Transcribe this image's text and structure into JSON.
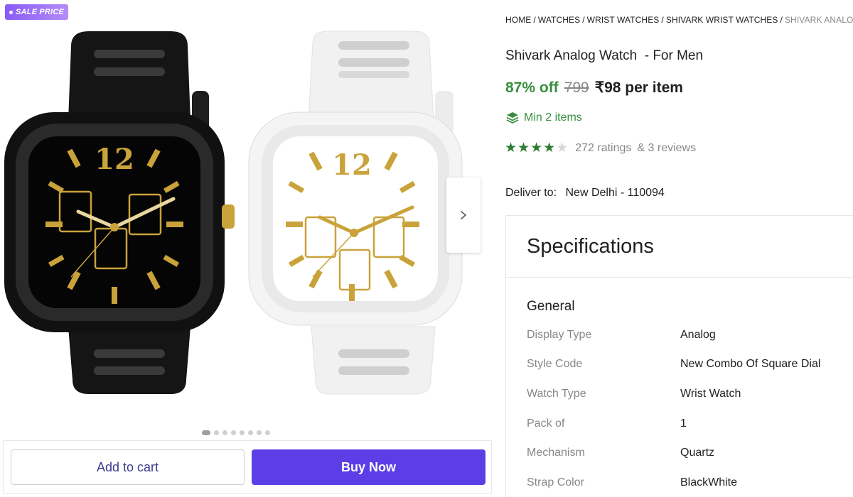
{
  "badge": {
    "label": "SALE PRICE"
  },
  "gallery": {
    "image_alt": "Pack of two square-dial analog watches, black and white",
    "dial_numeral": "12",
    "dots_count": 8,
    "active_dot": 0
  },
  "actions": {
    "add_to_cart": "Add to cart",
    "buy_now": "Buy Now"
  },
  "breadcrumb": [
    "HOME",
    "WATCHES",
    "WRIST WATCHES",
    "SHIVARK WRIST WATCHES"
  ],
  "breadcrumb_current": "SHIVARK ANALO",
  "product": {
    "title": "Shivark Analog Watch  - For Men",
    "discount": "87% off",
    "mrp": "799",
    "price": "₹98 per item",
    "min_items": "Min 2 items",
    "rating": 4,
    "rating_max": 5,
    "ratings_text": "272 ratings",
    "reviews_text": "& 3 reviews"
  },
  "delivery": {
    "label": "Deliver to:",
    "location": "New Delhi - 110094"
  },
  "specifications": {
    "title": "Specifications",
    "group": "General",
    "rows": [
      {
        "key": "Display Type",
        "value": "Analog"
      },
      {
        "key": "Style Code",
        "value": "New Combo Of Square Dial"
      },
      {
        "key": "Watch Type",
        "value": "Wrist Watch"
      },
      {
        "key": "Pack of",
        "value": "1"
      },
      {
        "key": "Mechanism",
        "value": "Quartz"
      },
      {
        "key": "Strap Color",
        "value": "BlackWhite"
      }
    ]
  },
  "colors": {
    "discount_green": "#388e3c",
    "buy_button": "#5b3ee6",
    "badge_purple": "#8a5cf6",
    "watch_gold": "#c9a23a"
  },
  "icons": {
    "next": "chevron-right-icon",
    "min_items": "layers-icon",
    "star": "star-icon"
  }
}
